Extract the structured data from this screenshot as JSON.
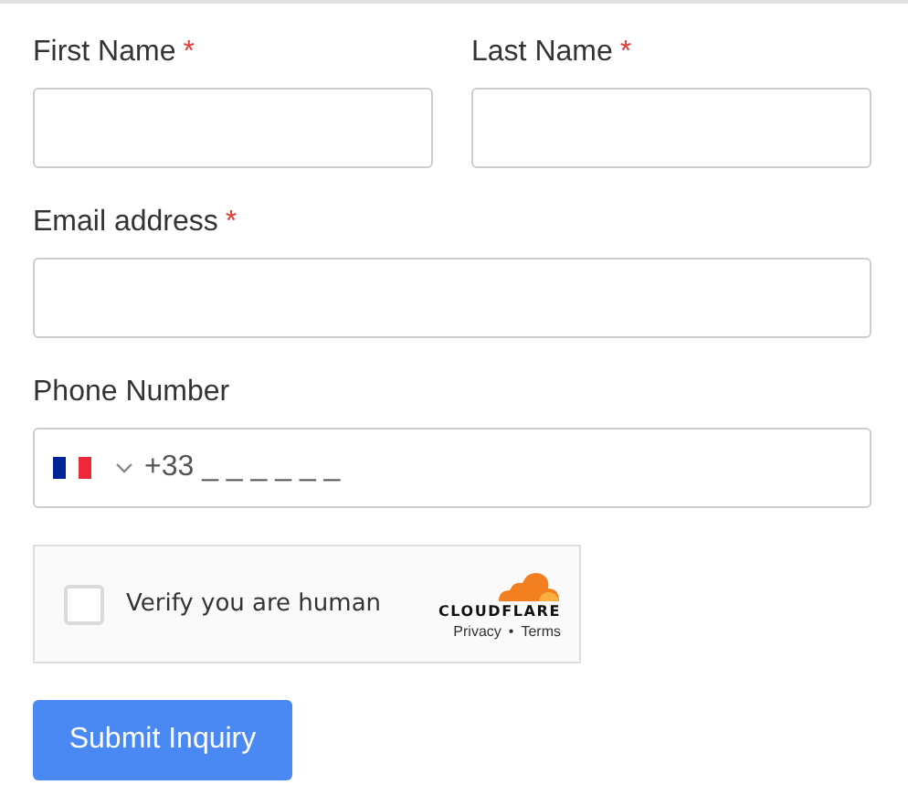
{
  "form": {
    "rows": [
      [
        {
          "label": "First Name",
          "required_mark": "*",
          "kind": "text"
        },
        {
          "label": "Last Name",
          "required_mark": "*",
          "kind": "text"
        }
      ],
      [
        {
          "label": "Email address",
          "required_mark": "*",
          "kind": "text"
        }
      ],
      [
        {
          "label": "Phone Number",
          "kind": "phone",
          "value": "+33 _ _ _ _ _ _"
        }
      ]
    ],
    "captcha": {
      "checked": false,
      "label": "Verify you are human",
      "brand": "CLOUDFLARE",
      "links": [
        "Privacy",
        "Terms"
      ],
      "separator": "•"
    },
    "submit": "Submit Inquiry"
  }
}
